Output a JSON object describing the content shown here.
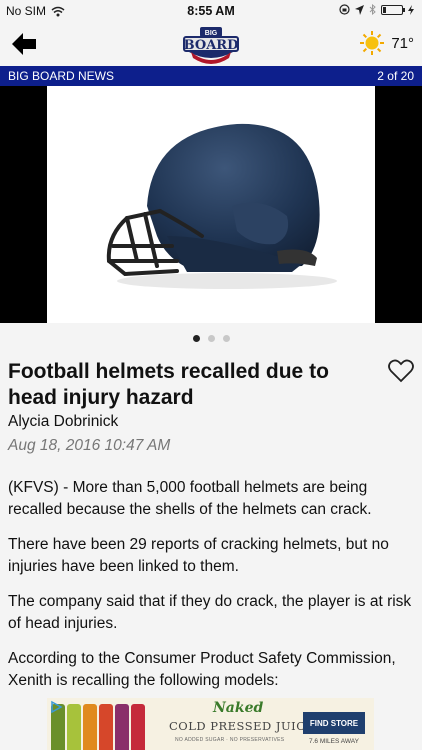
{
  "status_bar": {
    "carrier": "No SIM",
    "time": "8:55 AM"
  },
  "nav": {
    "logo_small_text": "BIG",
    "logo_text": "BOARD",
    "temperature": "71°"
  },
  "section": {
    "title": "BIG BOARD NEWS",
    "page_count": "2 of 20"
  },
  "gallery": {
    "dots": 3,
    "active_index": 0
  },
  "article": {
    "headline": "Football helmets recalled due to head injury hazard",
    "author": "Alycia Dobrinick",
    "date": "Aug 18, 2016 10:47 AM",
    "paragraphs": [
      "(KFVS) - More than 5,000 football helmets are being recalled because the shells of the helmets can crack.",
      "There have been 29 reports of cracking helmets, but no injuries have been linked to them.",
      "The company said that if they do crack, the player is at risk of head injuries.",
      "According to the Consumer Product Safety Commission, Xenith is recalling the following models:"
    ]
  },
  "ad": {
    "brand": "Naked",
    "title": "COLD PRESSED JUICE",
    "subtitle": "NO ADDED SUGAR · NO PRESERVATIVES",
    "cta": "FIND STORE",
    "distance": "7.6 MILES AWAY",
    "bottle_colors": [
      "#6a8f2a",
      "#a7c23b",
      "#e08a1e",
      "#d6472a",
      "#8a2f6a",
      "#c52a3b"
    ]
  },
  "colors": {
    "section_bar": "#0d1f8c",
    "helmet": "#1f3452"
  }
}
